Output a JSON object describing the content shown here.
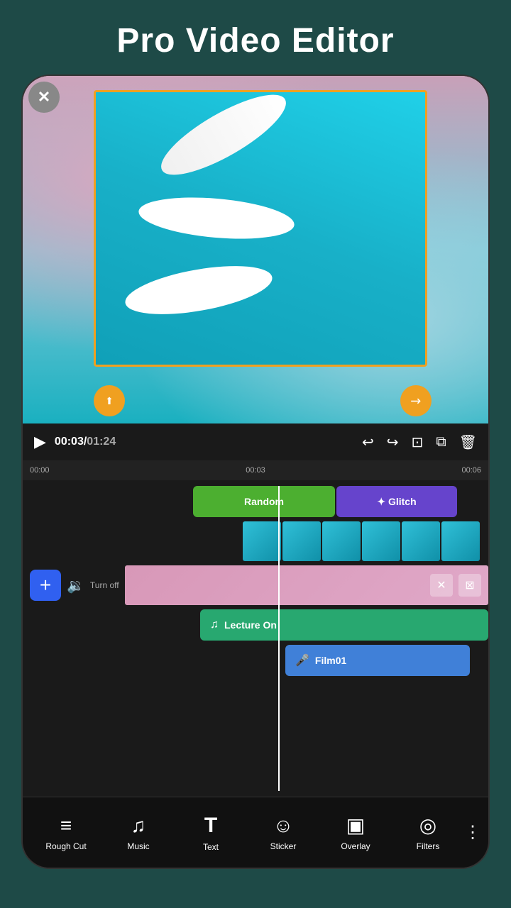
{
  "app": {
    "title": "Pro Video Editor"
  },
  "video_preview": {
    "close_icon": "✕",
    "move_icon": "⬆",
    "resize_icon": "↗"
  },
  "playback": {
    "play_icon": "▶",
    "current_time": "00:03",
    "separator": "/",
    "total_time": "01:24",
    "undo_icon": "↩",
    "redo_icon": "↪",
    "split_icon": "⊡",
    "copy_icon": "⧉",
    "delete_icon": "🗑"
  },
  "timeline": {
    "ruler_marks": [
      "00:00",
      "00:03",
      "00:06"
    ],
    "filters": [
      {
        "label": "Random",
        "type": "green"
      },
      {
        "label": "✦ Glitch",
        "type": "purple"
      }
    ],
    "music_track": {
      "icon": "♫",
      "label": "Lecture On"
    },
    "voice_track": {
      "icon": "🎤",
      "label": "Film01"
    },
    "volume_label": "Turn off",
    "add_label": "+"
  },
  "bottom_toolbar": {
    "items": [
      {
        "id": "rough-cut",
        "icon": "≡",
        "label": "Rough Cut",
        "icon_type": "grid"
      },
      {
        "id": "music",
        "icon": "♫",
        "label": "Music"
      },
      {
        "id": "text",
        "icon": "T",
        "label": "Text"
      },
      {
        "id": "sticker",
        "icon": "☺",
        "label": "Sticker"
      },
      {
        "id": "overlay",
        "icon": "▣",
        "label": "Overlay"
      },
      {
        "id": "filters",
        "icon": "◎",
        "label": "Filters"
      }
    ],
    "more_icon": "⋮"
  }
}
